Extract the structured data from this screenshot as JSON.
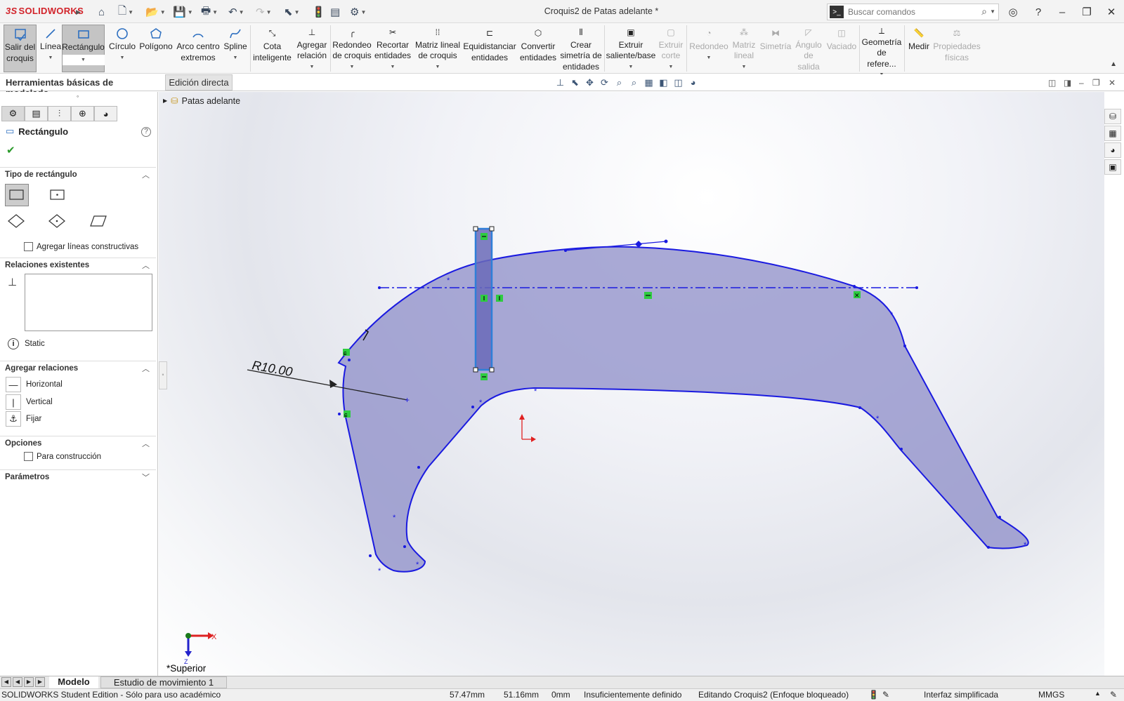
{
  "app": {
    "brand_ds": "3S",
    "brand_name": "SOLIDWORKS",
    "window_title": "Croquis2 de Patas adelante *"
  },
  "search": {
    "placeholder": "Buscar comandos"
  },
  "ribbon": {
    "exit_sketch": [
      "Salir del",
      "croquis"
    ],
    "line": "Línea",
    "rectangle": "Rectángulo",
    "circle": "Círculo",
    "polygon": "Polígono",
    "arc": [
      "Arco centro",
      "extremos"
    ],
    "spline": "Spline",
    "smart_dim": [
      "Cota",
      "inteligente"
    ],
    "add_relation": [
      "Agregar",
      "relación"
    ],
    "fillet": [
      "Redondeo",
      "de croquis"
    ],
    "trim": [
      "Recortar",
      "entidades"
    ],
    "pattern": [
      "Matriz lineal",
      "de croquis"
    ],
    "offset": [
      "Equidistanciar",
      "entidades"
    ],
    "convert": [
      "Convertir",
      "entidades"
    ],
    "mirror": [
      "Crear",
      "simetría de",
      "entidades"
    ],
    "extrude": [
      "Extruir",
      "saliente/base"
    ],
    "cut": [
      "Extruir",
      "corte"
    ],
    "fillet3d": "Redondeo",
    "lin_pattern": [
      "Matriz",
      "lineal"
    ],
    "symmetry": "Simetría",
    "draft": [
      "Ángulo",
      "de",
      "salida"
    ],
    "shell": "Vaciado",
    "ref_geom": [
      "Geometría",
      "de refere..."
    ],
    "measure": "Medir",
    "mass_props": [
      "Propiedades",
      "físicas"
    ]
  },
  "tabs": {
    "active": "Herramientas básicas de modelado",
    "inactive": "Edición directa"
  },
  "tree": {
    "root": "Patas adelante"
  },
  "property_manager": {
    "title": "Rectángulo",
    "sections": {
      "rect_type": "Tipo de rectángulo",
      "construction_lines": "Agregar líneas constructivas",
      "existing_relations": "Relaciones existentes",
      "status": "Static",
      "add_relations": "Agregar relaciones",
      "options": "Opciones",
      "for_construction": "Para construcción",
      "parameters": "Parámetros"
    },
    "relations": [
      "Horizontal",
      "Vertical",
      "Fijar"
    ]
  },
  "sketch": {
    "dimension": "R10.00",
    "view_label": "*Superior"
  },
  "bottom_tabs": {
    "model": "Modelo",
    "motion": "Estudio de movimiento 1"
  },
  "status": {
    "edition": "SOLIDWORKS Student Edition - Sólo para uso académico",
    "x": "57.47mm",
    "y": "51.16mm",
    "z": "0mm",
    "definition": "Insuficientemente definido",
    "editing": "Editando Croquis2 (Enfoque bloqueado)",
    "interface": "Interfaz simplificada",
    "units": "MMGS"
  },
  "colors": {
    "sketch_line": "#1a1ae0",
    "fill": "#8e8ec8",
    "selected": "#2f7fd8",
    "relation": "#2ecc40"
  }
}
